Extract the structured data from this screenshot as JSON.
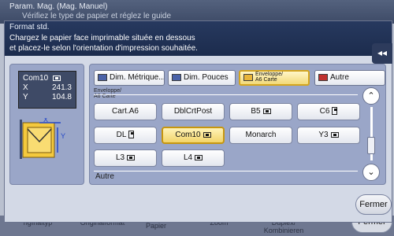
{
  "background": {
    "title": "Param. Mag. (Mag. Manuel)",
    "subtitle": "Vérifiez le type de papier et réglez le guide",
    "bottom_tabs": [
      "rigInaltyp",
      "Originalformat",
      "Papier",
      "Zoom",
      "Duplex/\nKombinieren"
    ],
    "close_label": "Fermer"
  },
  "dialog": {
    "title": "Format std.",
    "message_line1": "Chargez le papier face imprimable située en dessous",
    "message_line2": "et placez-le selon l'orientation d'impression souhaitée.",
    "side_button": "◂◂",
    "current_size": {
      "name": "Com10",
      "x_label": "X",
      "x_value": "241.3",
      "y_label": "Y",
      "y_value": "104.8"
    },
    "illustration_labels": {
      "x": "X",
      "y": "Y"
    },
    "tabs": [
      {
        "label": "Dim. Métrique...",
        "icon": "metric-icon"
      },
      {
        "label": "Dim. Pouces",
        "icon": "inch-icon"
      },
      {
        "label_line1": "Enveloppe/",
        "label_line2": "A6 Carte",
        "icon": "envelope-icon"
      },
      {
        "label": "Autre",
        "icon": "other-icon"
      }
    ],
    "category_line1": "Enveloppe/",
    "category_line2": "A6 Carte",
    "sizes": [
      {
        "label": "Cart.A6"
      },
      {
        "label": "DblCrtPost"
      },
      {
        "label": "B5"
      },
      {
        "label": "C6"
      },
      {
        "label": "DL"
      },
      {
        "label": "Com10"
      },
      {
        "label": "Monarch"
      },
      {
        "label": "Y3"
      },
      {
        "label": "L3"
      },
      {
        "label": "L4"
      }
    ],
    "other_label": "Autre",
    "close_label": "Fermer"
  }
}
